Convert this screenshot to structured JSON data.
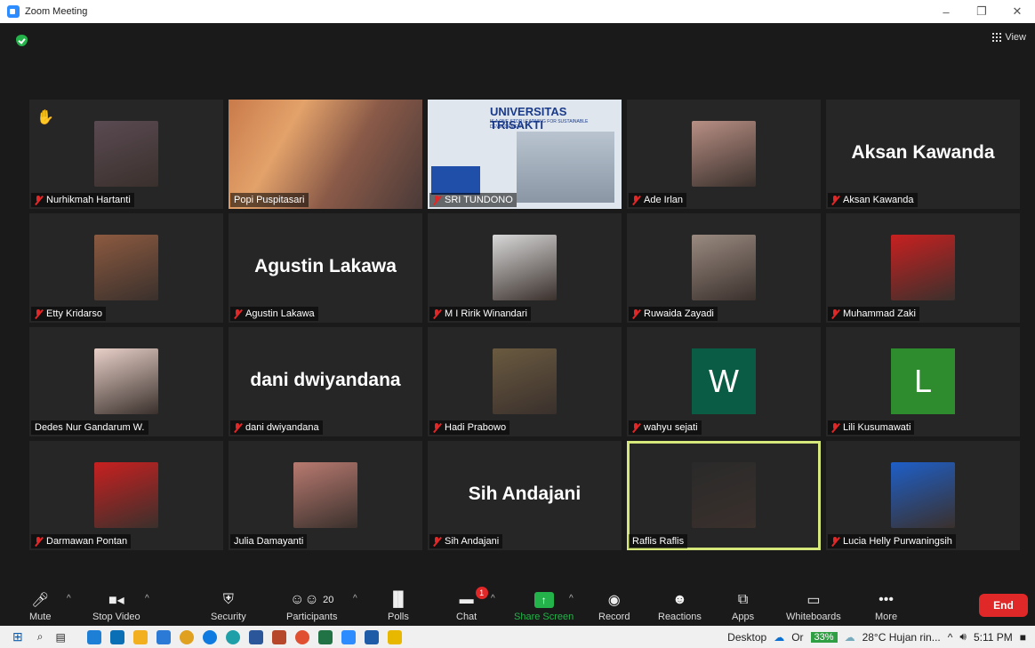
{
  "window": {
    "title": "Zoom Meeting"
  },
  "meeting": {
    "view_label": "View"
  },
  "participants": [
    {
      "name": "Nurhikmah Hartanti",
      "muted": true,
      "hand": true,
      "display": "photo",
      "color": "#5a4a52"
    },
    {
      "name": "Popi Puspitasari",
      "muted": false,
      "display": "video",
      "color": "#8a5a48"
    },
    {
      "name": "SRI TUNDONO",
      "muted": true,
      "display": "share",
      "share_title": "UNIVERSITAS TRISAKTI",
      "share_subtitle": "IS A ONE STOP LEARNING FOR SUSTAINABLE DEVELOPMENT",
      "color": "#dfe6ee"
    },
    {
      "name": "Ade Irlan",
      "muted": true,
      "display": "photo",
      "color": "#b88f84"
    },
    {
      "name": "Aksan Kawanda",
      "muted": true,
      "display": "name"
    },
    {
      "name": "Etty Kridarso",
      "muted": true,
      "display": "photo",
      "color": "#8c5a40"
    },
    {
      "name": "Agustin Lakawa",
      "muted": true,
      "display": "name"
    },
    {
      "name": "M I Ririk Winandari",
      "muted": true,
      "display": "photo",
      "color": "#d8d8d8"
    },
    {
      "name": "Ruwaida Zayadi",
      "muted": true,
      "display": "photo",
      "color": "#9a8a80"
    },
    {
      "name": "Muhammad Zaki",
      "muted": true,
      "display": "photo",
      "color": "#c82020"
    },
    {
      "name": "Dedes Nur Gandarum W.",
      "muted": false,
      "display": "photo",
      "color": "#e8d0c8"
    },
    {
      "name": "dani dwiyandana",
      "muted": true,
      "display": "name"
    },
    {
      "name": "Hadi Prabowo",
      "muted": true,
      "display": "photo",
      "color": "#6a5a40"
    },
    {
      "name": "wahyu sejati",
      "muted": true,
      "display": "letter",
      "letter": "W",
      "color": "#0b5c45"
    },
    {
      "name": "Lili Kusumawati",
      "muted": true,
      "display": "letter",
      "letter": "L",
      "color": "#2e8b2e"
    },
    {
      "name": "Darmawan Pontan",
      "muted": true,
      "display": "photo",
      "color": "#c82020"
    },
    {
      "name": "Julia Damayanti",
      "muted": false,
      "display": "photo",
      "color": "#b87a70"
    },
    {
      "name": "Sih Andajani",
      "muted": true,
      "display": "name"
    },
    {
      "name": "Raflis Raflis",
      "muted": false,
      "display": "photo",
      "active": true,
      "color": "#2a2a2a"
    },
    {
      "name": "Lucia Helly Purwaningsih",
      "muted": true,
      "display": "photo",
      "color": "#1e5fc8"
    }
  ],
  "toolbar": {
    "mute": "Mute",
    "stop_video": "Stop Video",
    "security": "Security",
    "participants": "Participants",
    "participants_count": "20",
    "polls": "Polls",
    "chat": "Chat",
    "chat_badge": "1",
    "share_screen": "Share Screen",
    "record": "Record",
    "reactions": "Reactions",
    "apps": "Apps",
    "whiteboards": "Whiteboards",
    "more": "More",
    "end": "End"
  },
  "taskbar": {
    "desktop_label": "Desktop",
    "onedrive_label": "Or",
    "battery": "33%",
    "weather": "28°C Hujan rin...",
    "time": "5:11 PM"
  },
  "colors": {
    "accent_green": "#23b34a",
    "end_red": "#e02828",
    "active_border": "#d6e87a"
  }
}
